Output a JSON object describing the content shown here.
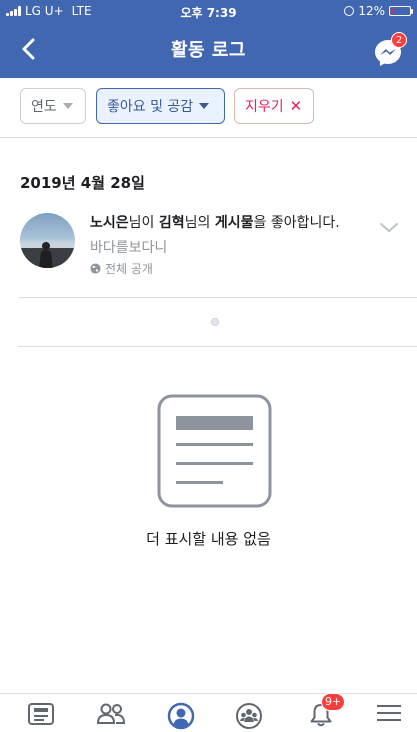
{
  "status_bar": {
    "carrier": "LG U+",
    "network": "LTE",
    "time": "오후 7:39",
    "battery": "12%",
    "battery_level": 0.12
  },
  "header": {
    "title": "활동 로그",
    "messenger_badge": "2"
  },
  "filters": {
    "year_label": "연도",
    "likes_label": "좋아요 및 공감",
    "clear_label": "지우기"
  },
  "date_header": "2019년 4월 28일",
  "activity": {
    "actor": "노시은",
    "part1": "님이 ",
    "target": "김혁",
    "part2": "님의 ",
    "object": "게시물",
    "part3": "을 좋아합니다.",
    "subtitle": "바다를보다니",
    "privacy": "전체 공개"
  },
  "empty_state": {
    "text": "더 표시할 내용 없음"
  },
  "tabbar": {
    "notifications_badge": "9+",
    "active_tab": "profile"
  },
  "colors": {
    "brand": "#4267b2",
    "badge": "#fa3e3e",
    "clear": "#e0245e",
    "active_tab": "#4267b2",
    "inactive_tab": "#606770"
  }
}
